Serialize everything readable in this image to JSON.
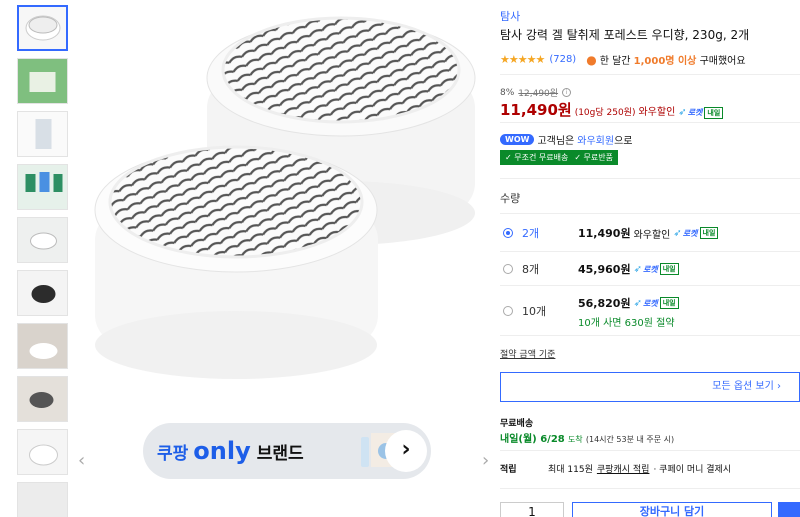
{
  "gallery": {
    "thumbnail_count": 10,
    "prev_arrow": "‹",
    "next_arrow": "›"
  },
  "banner": {
    "coupang": "쿠팡",
    "only": "only",
    "brand": "브랜드",
    "arrow": "›"
  },
  "product": {
    "brand": "탐사",
    "title": "탐사 강력 겔 탈취제 포레스트 우디향, 230g, 2개",
    "stars": "★★★★★",
    "rating": 4.5,
    "review_count": "(728)",
    "purchase_prefix": "한 달간",
    "purchase_count": "1,000명 이상",
    "purchase_suffix": "구매했어요"
  },
  "pricing": {
    "discount_rate": "8%",
    "original_price": "12,490원",
    "info_icon": "i",
    "price": "11,490원",
    "unit_price": "(10g당 250원)",
    "wow_discount": "와우할인",
    "rocket": "로켓",
    "tomorrow": "내일"
  },
  "membership": {
    "badge": "WOW",
    "text_prefix": "고객님은",
    "highlight": "와우회원",
    "text_suffix": "으로",
    "free_shipping": "✓ 무조건 무료배송",
    "free_return": "✓ 무료반품"
  },
  "options": {
    "label": "수량",
    "items": [
      {
        "qty": "2개",
        "price": "11,490원",
        "extra": "와우할인",
        "selected": true
      },
      {
        "qty": "8개",
        "price": "45,960원",
        "extra": "",
        "selected": false
      },
      {
        "qty": "10개",
        "price": "56,820원",
        "extra": "",
        "saving": "10개 사면 630원 절약",
        "selected": false
      }
    ],
    "saving_standard": "절약 금액 기준",
    "all_options": "모든 옵션 보기 ›"
  },
  "shipping": {
    "label": "무료배송",
    "arrival_day": "내일(월) 6/28",
    "arrival_suffix": "도착",
    "deadline": "(14시간 53분 내 주문 시)"
  },
  "reward": {
    "label": "적립",
    "prefix": "최대 115원",
    "link": "쿠팡캐시 적립",
    "suffix": "· 쿠페이 머니 결제시"
  },
  "purchase": {
    "quantity": "1",
    "cart_button": "장바구니 담기"
  },
  "colors": {
    "accent": "#346aff",
    "price_red": "#ae0000",
    "green": "#0a8a2a",
    "star": "#f5a623"
  }
}
